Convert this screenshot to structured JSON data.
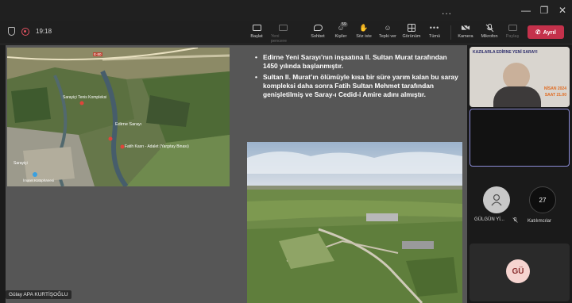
{
  "window": {
    "more_dots": "...",
    "minimize": "—",
    "maximize": "❐",
    "close": "✕"
  },
  "toolbar": {
    "timer": "19:18",
    "buttons": [
      {
        "label": "Başlat",
        "icon": "share-icon"
      },
      {
        "label": "Yeni pencere",
        "icon": "new-window-icon"
      },
      {
        "label": "Sohbet",
        "icon": "chat-icon"
      },
      {
        "label": "Kişiler",
        "icon": "people-icon",
        "badge": "59"
      },
      {
        "label": "Söz iste",
        "icon": "raise-hand-icon"
      },
      {
        "label": "Tepki ver",
        "icon": "react-icon"
      },
      {
        "label": "Görünüm",
        "icon": "view-icon"
      },
      {
        "label": "Tümü",
        "icon": "more-icon"
      },
      {
        "label": "Kamera",
        "icon": "camera-off-icon"
      },
      {
        "label": "Mikrofon",
        "icon": "mic-off-icon"
      },
      {
        "label": "Paylaş",
        "icon": "share-screen-icon"
      }
    ],
    "leave_label": "Ayrıl"
  },
  "slide": {
    "bullets": [
      "Edirne Yeni Sarayı’nın inşaatına II. Sultan Murat tarafından 1450 yılında başlanmıştır.",
      "Sultan II. Murat’ın ölümüyle kısa bir süre yarım kalan bu saray kompleksi daha sonra Fatih Sultan Mehmet tarafından genişletilmiş ve Saray-ı Cedid-i Amire adını almıştır."
    ],
    "map_labels": {
      "road": "E-80",
      "park": "Sarayiçi Tenis Kompleksi",
      "palace": "Edirne Sarayı",
      "pavilion": "Fatih Kasrı - Adalet (Yargıtay Binası)",
      "district": "Sarayiçi",
      "library": "İmaret Kütüphanesi"
    },
    "presenter_name": "Gülay APA KURTİŞOĞLU"
  },
  "participants": {
    "video_banner": "KAZILARLA EDİRNE YENİ SARAYI",
    "video_date": "NİSAN 2024",
    "video_time": "SAAT 21.00",
    "person1_name": "GÜLGÜN Yİ...",
    "count": "27",
    "count_label": "Katılımcılar",
    "initials": "GÜ"
  },
  "colors": {
    "leave": "#c4314b",
    "active_tile_border": "#8b8bd6",
    "avatar_pink": "#f6d4d0"
  }
}
